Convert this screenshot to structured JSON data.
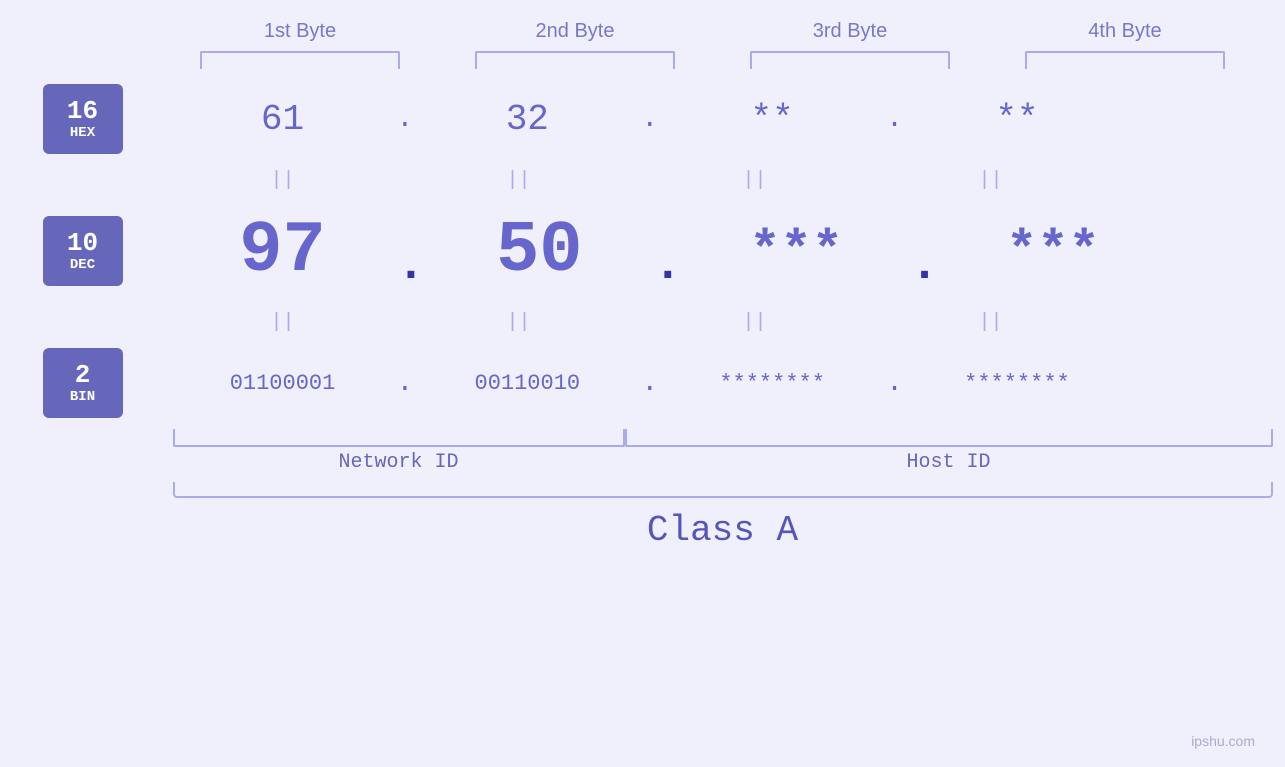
{
  "headers": {
    "byte1": "1st Byte",
    "byte2": "2nd Byte",
    "byte3": "3rd Byte",
    "byte4": "4th Byte"
  },
  "bases": {
    "hex": {
      "num": "16",
      "name": "HEX"
    },
    "dec": {
      "num": "10",
      "name": "DEC"
    },
    "bin": {
      "num": "2",
      "name": "BIN"
    }
  },
  "hex_row": {
    "b1": "61",
    "b2": "32",
    "b3": "**",
    "b4": "**"
  },
  "dec_row": {
    "b1": "97",
    "b2": "50",
    "b3": "***",
    "b4": "***"
  },
  "bin_row": {
    "b1": "01100001",
    "b2": "00110010",
    "b3": "********",
    "b4": "********"
  },
  "labels": {
    "network_id": "Network ID",
    "host_id": "Host ID",
    "class": "Class A"
  },
  "watermark": "ipshu.com",
  "separator": "||",
  "dot": ".",
  "accent_color": "#6666cc",
  "bracket_color": "#aaaaee"
}
